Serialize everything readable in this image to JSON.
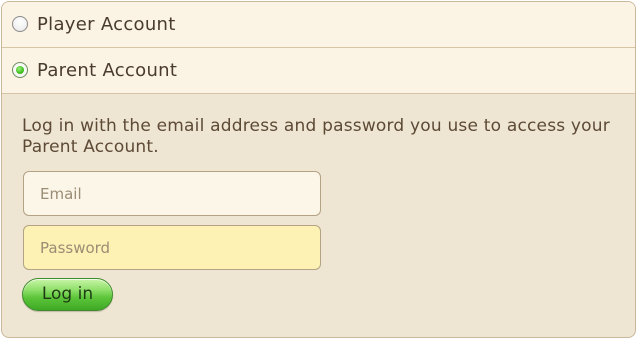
{
  "account_options": {
    "player": {
      "label": "Player Account",
      "selected": false
    },
    "parent": {
      "label": "Parent Account",
      "selected": true
    }
  },
  "login_form": {
    "instructions": "Log in with the email address and password you use to access your Parent Account.",
    "email_placeholder": "Email",
    "email_value": "",
    "password_placeholder": "Password",
    "password_value": "",
    "login_label": "Log in"
  },
  "colors": {
    "panel_background": "#efe5d3",
    "option_row_background": "#fbf3e4",
    "password_field_background": "#fdf2b3",
    "login_button_green": "#5cc53a",
    "selected_radio_green": "#3fbf1f"
  }
}
